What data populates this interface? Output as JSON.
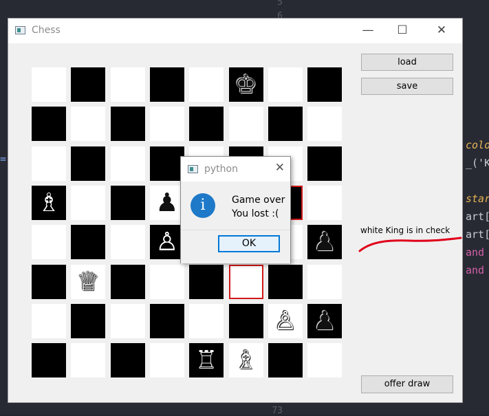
{
  "editor": {
    "line_numbers": [
      "5",
      "6",
      "73"
    ],
    "fragments": [
      "colo",
      "_('K",
      "star",
      "art[",
      "art[",
      "and",
      "and",
      "="
    ]
  },
  "window": {
    "title": "Chess",
    "minimize_glyph": "—",
    "maximize_glyph": "☐",
    "close_glyph": "✕"
  },
  "buttons": {
    "load": "load",
    "save": "save",
    "offer_draw": "offer draw"
  },
  "status_text": "white King is in check",
  "annotation_color": "#e0001a",
  "board": {
    "rows": [
      [
        "",
        "",
        "",
        "",
        "",
        "♚",
        "",
        ""
      ],
      [
        "",
        "",
        "",
        "",
        "",
        "",
        "",
        ""
      ],
      [
        "",
        "",
        "",
        "",
        "",
        "",
        "",
        ""
      ],
      [
        "♗",
        "",
        "",
        "♟",
        "",
        "",
        "",
        ""
      ],
      [
        "",
        "",
        "",
        "♙",
        "",
        "",
        "",
        "♟"
      ],
      [
        "",
        "♕",
        "",
        "",
        "",
        "",
        "",
        ""
      ],
      [
        "",
        "",
        "",
        "",
        "",
        "",
        "♙",
        "♟"
      ],
      [
        "",
        "",
        "",
        "",
        "♖",
        "♗",
        "",
        ""
      ]
    ],
    "highlighted": [
      "f3",
      "g5"
    ]
  },
  "dialog": {
    "title": "python",
    "close_glyph": "✕",
    "icon": "info-icon",
    "icon_glyph": "i",
    "line1": "Game over",
    "line2": "You lost :(",
    "ok": "OK"
  }
}
